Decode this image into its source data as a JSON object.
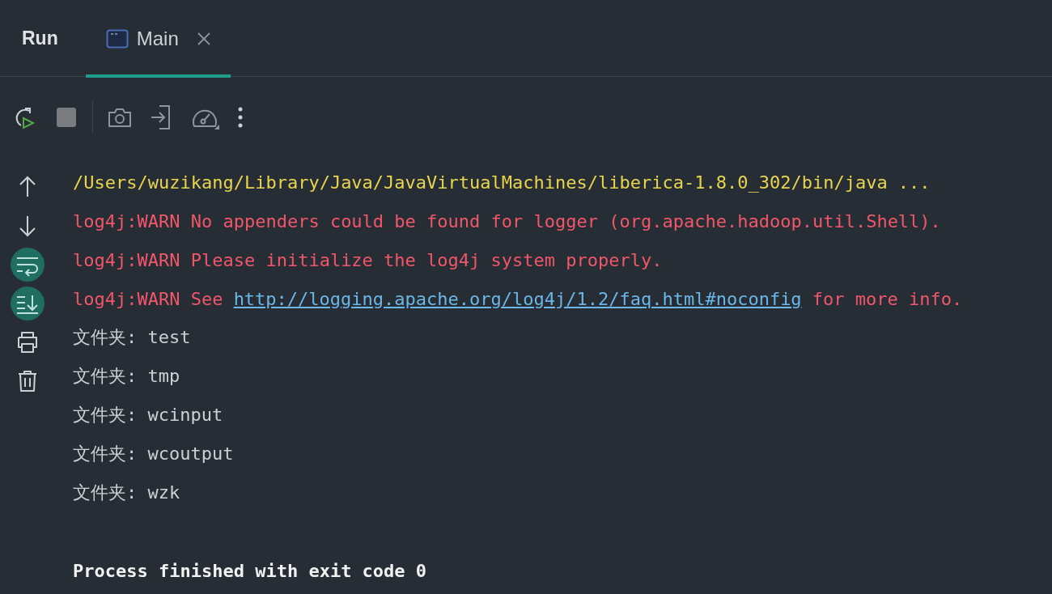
{
  "panel": {
    "title": "Run"
  },
  "tabs": [
    {
      "label": "Main",
      "selected": true,
      "closable": true
    }
  ],
  "toolbar": [
    {
      "kind": "rerun"
    },
    {
      "kind": "stop"
    },
    {
      "kind": "camera"
    },
    {
      "kind": "login"
    },
    {
      "kind": "gauge"
    },
    {
      "kind": "more"
    }
  ],
  "side_tools": [
    {
      "kind": "up",
      "on": false
    },
    {
      "kind": "down",
      "on": false
    },
    {
      "kind": "wrap",
      "on": true
    },
    {
      "kind": "scroll",
      "on": true
    },
    {
      "kind": "print",
      "on": false
    },
    {
      "kind": "trash",
      "on": false
    }
  ],
  "console": [
    {
      "kind": "command",
      "segments": [
        {
          "text": "/Users/wuzikang/Library/Java/JavaVirtualMachines/liberica-1.8.0_302/bin/java ...",
          "link": false
        }
      ]
    },
    {
      "kind": "warn",
      "segments": [
        {
          "text": "log4j:WARN No appenders could be found for logger (org.apache.hadoop.util.Shell).",
          "link": false
        }
      ]
    },
    {
      "kind": "warn",
      "segments": [
        {
          "text": "log4j:WARN Please initialize the log4j system properly.",
          "link": false
        }
      ]
    },
    {
      "kind": "warn",
      "segments": [
        {
          "text": "log4j:WARN See",
          "link": false
        },
        {
          "text": "http://logging.apache.org/log4j/1.2/faq.html#noconfig",
          "link": true
        },
        {
          "text": "for more info.",
          "link": false
        }
      ]
    },
    {
      "kind": "output",
      "segments": [
        {
          "text": "文件夹: test",
          "link": false
        }
      ]
    },
    {
      "kind": "output",
      "segments": [
        {
          "text": "文件夹: tmp",
          "link": false
        }
      ]
    },
    {
      "kind": "output",
      "segments": [
        {
          "text": "文件夹: wcinput",
          "link": false
        }
      ]
    },
    {
      "kind": "output",
      "segments": [
        {
          "text": "文件夹: wcoutput",
          "link": false
        }
      ]
    },
    {
      "kind": "output",
      "segments": [
        {
          "text": "文件夹: wzk",
          "link": false
        }
      ]
    },
    {
      "kind": "exit",
      "segments": [
        {
          "text": "Process finished with exit code 0",
          "link": false
        }
      ]
    }
  ]
}
